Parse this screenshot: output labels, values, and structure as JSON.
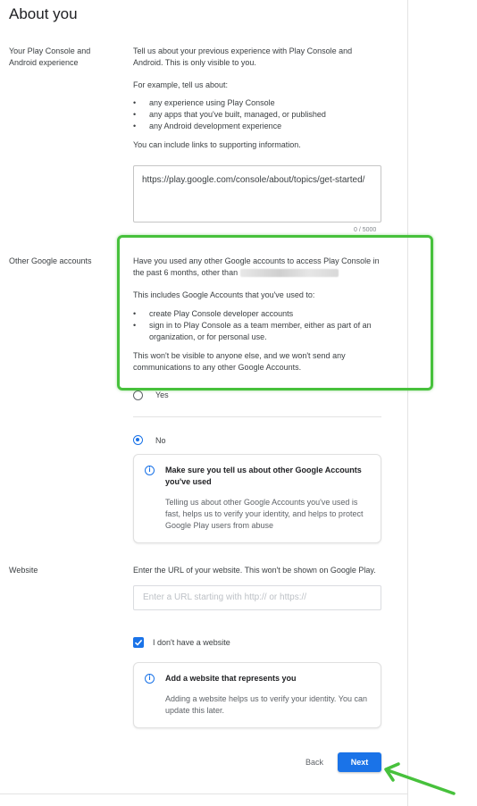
{
  "page": {
    "title": "About you"
  },
  "experience": {
    "label": "Your Play Console and Android experience",
    "intro": "Tell us about your previous experience with Play Console and Android. This is only visible to you.",
    "example_heading": "For example, tell us about:",
    "bullets": [
      "any experience using Play Console",
      "any apps that you've built, managed, or published",
      "any Android development experience"
    ],
    "links_note": "You can include links to supporting information.",
    "textarea_value": "https://play.google.com/console/about/topics/get-started/",
    "counter": "0 / 5000"
  },
  "other_accounts": {
    "label": "Other Google accounts",
    "question_prefix": "Have you used any other Google accounts to access Play Console in the past 6 months, other than",
    "includes": "This includes Google Accounts that you've used to:",
    "bullets": [
      "create Play Console developer accounts",
      "sign in to Play Console as a team member, either as part of an organization, or for personal use."
    ],
    "visibility_note": "This won't be visible to anyone else, and we won't send any communications to any other Google Accounts.",
    "option_yes": "Yes",
    "option_no": "No",
    "card_title": "Make sure you tell us about other Google Accounts you've used",
    "card_text": "Telling us about other Google Accounts you've used is fast, helps us to verify your identity, and helps to protect Google Play users from abuse"
  },
  "website": {
    "label": "Website",
    "description": "Enter the URL of your website. This won't be shown on Google Play.",
    "placeholder": "Enter a URL starting with http:// or https://",
    "no_website_label": "I don't have a website",
    "card_title": "Add a website that represents you",
    "card_text": "Adding a website helps us to verify your identity. You can update this later."
  },
  "footer": {
    "back_label": "Back",
    "next_label": "Next"
  },
  "colors": {
    "accent": "#1a73e8",
    "highlight": "#47c13c"
  }
}
